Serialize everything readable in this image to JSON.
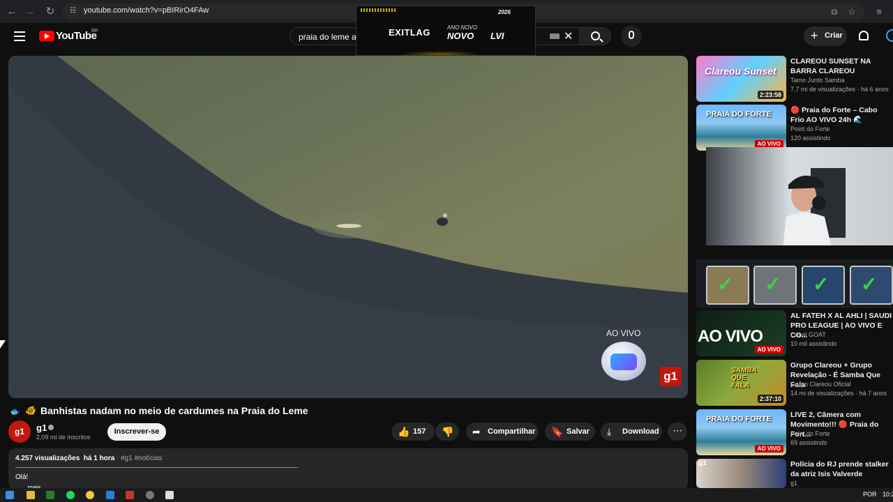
{
  "browser": {
    "url": "youtube.com/watch?v=pBIRirO4FAw"
  },
  "ad": {
    "brand": "EXITLAG",
    "year": "2026",
    "line1": "ANO NOVO",
    "line2": "NOVO",
    "line3": "LVI"
  },
  "header": {
    "logo_text": "YouTube",
    "region": "BR",
    "search_value": "praia do leme a",
    "create_label": "Criar"
  },
  "player": {
    "live_label": "AO VIVO",
    "g1_logo": "g1"
  },
  "video": {
    "title": "Banhistas nadam no meio de cardumes na Praia do Leme",
    "channel_name": "g1",
    "channel_avatar_text": "g1",
    "subscribers": "2,09 mi de inscritos",
    "subscribe_label": "Inscrever-se",
    "likes": "157",
    "share_label": "Compartilhar",
    "save_label": "Salvar",
    "download_label": "Download"
  },
  "description": {
    "views": "4.257 visualizações",
    "time": "há 1 hora",
    "tags": "#g1 #notícias",
    "text": "Olá!",
    "more": "...mais"
  },
  "recommendations": [
    {
      "title": "CLAREOU SUNSET NA BARRA CLAREOU",
      "channel": "Tamo Junto Samba",
      "meta": "7,7 mi de visualizações · há 6 anos",
      "duration": "2:23:58",
      "thumb_text": "Clareou Sunset"
    },
    {
      "title": "🔴 Praia do Forte – Cabo Frio AO VIVO 24h 🌊",
      "channel": "Point do Forte",
      "meta": "120 assistindo",
      "live": "AO VIVO",
      "thumb_text": "PRAIA DO FORTE"
    },
    {
      "title": "AL FATEH X AL AHLI | SAUDI PRO LEAGUE | AO VIVO E CO...",
      "channel": "Canal GOAT",
      "meta": "10 mil assistindo",
      "live": "AO VIVO",
      "thumb_text": "AO VIVO"
    },
    {
      "title": "Grupo Clareou + Grupo Revelação - É Samba Que Fala",
      "channel": "Grupo Clareou Oficial",
      "meta": "14 mi de visualizações · há 7 anos",
      "duration": "2:37:10",
      "thumb_text": "SAMBA QUE FALA"
    },
    {
      "title": "LIVE 2, Câmera com Movimento!!! 🔴 Praia do Fort...",
      "channel": "Point do Forte",
      "meta": "69 assistindo",
      "live": "AO VIVO",
      "thumb_text": "PRAIA DO FORTE"
    },
    {
      "title": "Polícia do RJ prende stalker da atriz Isis Valverde",
      "channel": "g1",
      "meta": "",
      "thumb_text": "g1"
    }
  ],
  "taskbar": {
    "lang": "POR",
    "time": "10:2"
  }
}
